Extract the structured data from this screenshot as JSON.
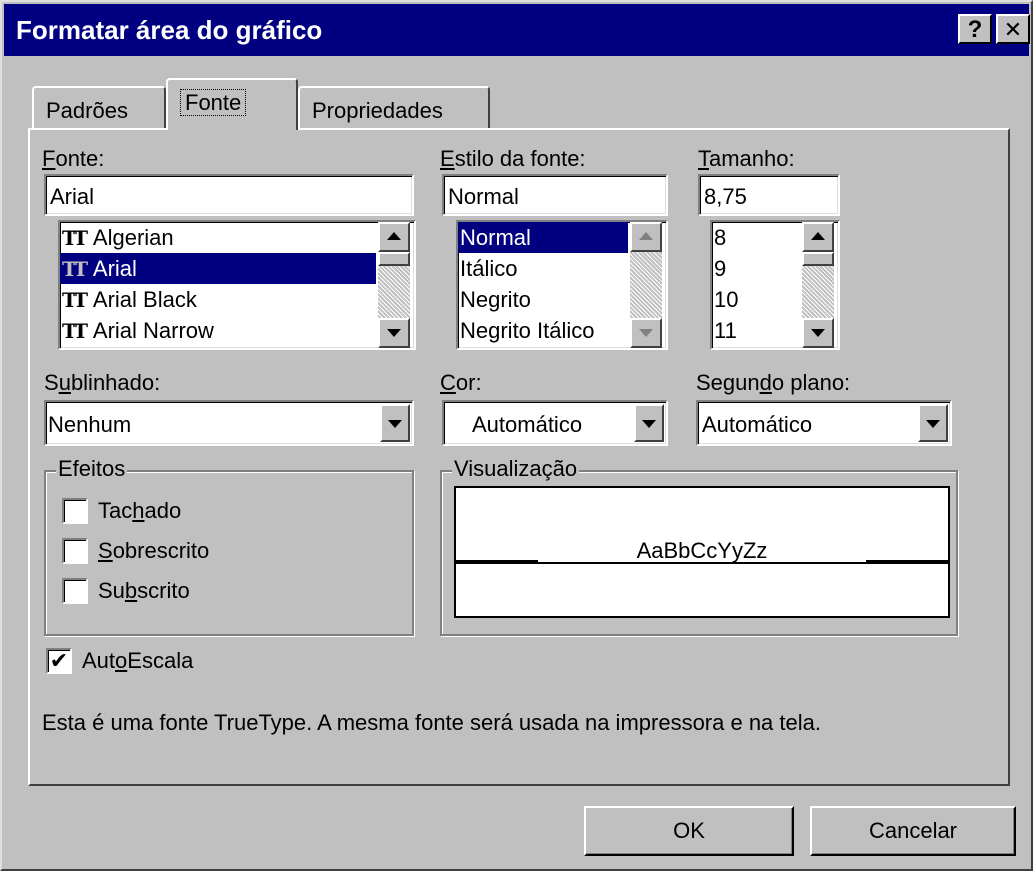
{
  "window": {
    "title": "Formatar área do gráfico",
    "help_label": "?",
    "close_label": "✕"
  },
  "tabs": [
    {
      "label": "Padrões",
      "active": false
    },
    {
      "label": "Fonte",
      "active": true
    },
    {
      "label": "Propriedades",
      "active": false
    }
  ],
  "font": {
    "label_prefix": "",
    "label_accel": "F",
    "label_rest": "onte:",
    "value": "Arial",
    "list": [
      "Algerian",
      "Arial",
      "Arial Black",
      "Arial Narrow"
    ],
    "selected": "Arial"
  },
  "style": {
    "label_accel": "E",
    "label_rest": "stilo da fonte:",
    "value": "Normal",
    "list": [
      "Normal",
      "Itálico",
      "Negrito",
      "Negrito Itálico"
    ],
    "selected": "Normal"
  },
  "size": {
    "label_accel": "T",
    "label_rest": "amanho:",
    "value": "8,75",
    "list": [
      "8",
      "9",
      "10",
      "11"
    ]
  },
  "underline": {
    "label_pre": "S",
    "label_accel": "u",
    "label_rest": "blinhado:",
    "value": "Nenhum"
  },
  "color": {
    "label_accel": "C",
    "label_rest": "or:",
    "value": "Automático"
  },
  "background": {
    "label_pre": "Segun",
    "label_accel": "d",
    "label_rest": "o plano:",
    "value": "Automático"
  },
  "effects": {
    "title": "Efeitos",
    "strikethrough": {
      "pre": "Tac",
      "accel": "h",
      "rest": "ado",
      "checked": false
    },
    "superscript": {
      "pre": "",
      "accel": "S",
      "rest": "obrescrito",
      "checked": false
    },
    "subscript": {
      "pre": "Su",
      "accel": "b",
      "rest": "scrito",
      "checked": false
    }
  },
  "preview": {
    "title": "Visualização",
    "sample": "AaBbCcYyZz"
  },
  "autoscale": {
    "pre": "Aut",
    "accel": "o",
    "rest": "Escala",
    "checked": true,
    "mark": "✔"
  },
  "info_text": "Esta é uma fonte TrueType. A mesma fonte será usada na impressora e na tela.",
  "buttons": {
    "ok": "OK",
    "cancel": "Cancelar"
  },
  "icons": {
    "truetype": "TT",
    "help": "question-mark-icon",
    "close": "close-icon"
  }
}
